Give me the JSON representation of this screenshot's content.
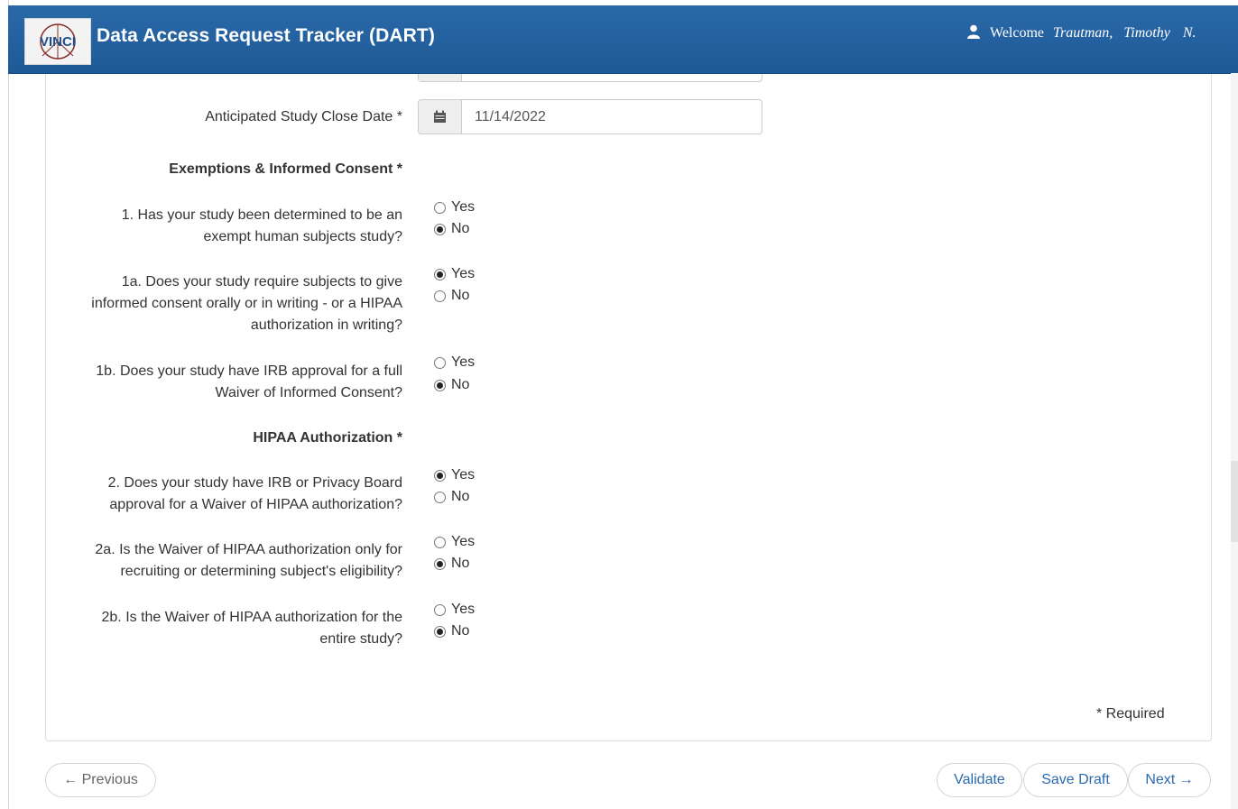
{
  "header": {
    "logo_text": "VINCI",
    "title": "Data Access Request Tracker (DART)",
    "welcome": "Welcome",
    "user_last": "Trautman,",
    "user_first": "Timothy",
    "user_middle": "N."
  },
  "form": {
    "close_date": {
      "label": "Anticipated Study Close Date *",
      "value": "11/14/2022",
      "icon": "calendar-icon"
    },
    "section_exemptions": "Exemptions & Informed Consent *",
    "section_hipaa": "HIPAA Authorization *",
    "questions": [
      {
        "id": "q1",
        "lines": [
          "1. Has your study been determined to be an",
          "exempt human subjects study?"
        ],
        "selected": "No"
      },
      {
        "id": "q1a",
        "lines": [
          "1a. Does your study require subjects to give",
          "informed consent orally or in writing - or a HIPAA",
          "authorization in writing?"
        ],
        "selected": "Yes"
      },
      {
        "id": "q1b",
        "lines": [
          "1b. Does your study have IRB approval for a full",
          "Waiver of Informed Consent?"
        ],
        "selected": "No"
      },
      {
        "id": "q2",
        "lines": [
          "2. Does your study have IRB or Privacy Board",
          "approval for a Waiver of HIPAA authorization?"
        ],
        "selected": "Yes"
      },
      {
        "id": "q2a",
        "lines": [
          "2a. Is the Waiver of HIPAA authorization only for",
          "recruiting or determining subject's eligibility?"
        ],
        "selected": "No"
      },
      {
        "id": "q2b",
        "lines": [
          "2b. Is the Waiver of HIPAA authorization for the",
          "entire study?"
        ],
        "selected": "No"
      }
    ],
    "option_yes": "Yes",
    "option_no": "No",
    "required_note": "* Required"
  },
  "nav": {
    "previous": "← Previous",
    "validate": "Validate",
    "save_draft": "Save Draft",
    "next": "Next →"
  },
  "colors": {
    "header_bg": "#2165a3",
    "link": "#2a6aad"
  }
}
